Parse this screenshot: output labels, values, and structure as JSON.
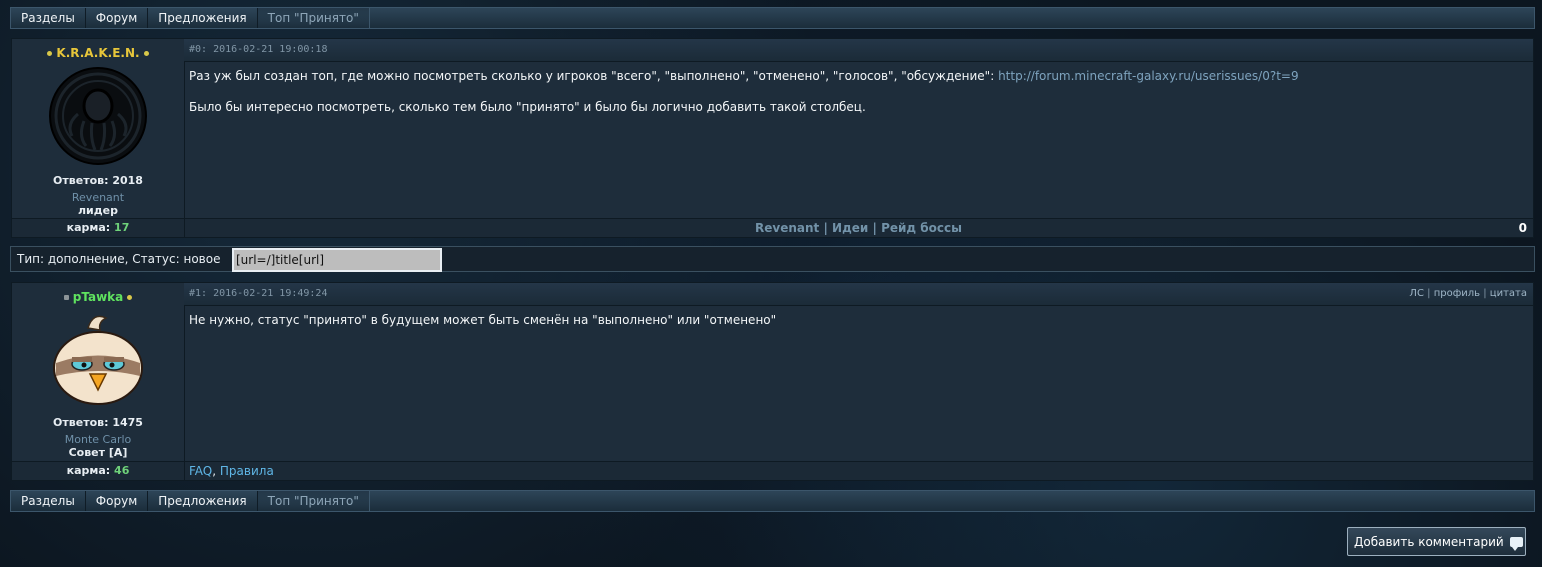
{
  "breadcrumb": {
    "items": [
      "Разделы",
      "Форум",
      "Предложения"
    ],
    "current": "Топ \"Принято\""
  },
  "posts": [
    {
      "author": "K.R.A.K.E.N.",
      "author_color": "#e7c63a",
      "avatar_icon": "kraken-avatar-icon",
      "replies": "Ответов: 2018",
      "clan": "Revenant",
      "rank": "лидер",
      "karma_label": "карма:",
      "karma_value": "17",
      "meta": "#0: 2016-02-21 19:00:18",
      "body_line1_text": "Раз уж был создан топ, где можно посмотреть сколько у игроков \"всего\", \"выполнено\", \"отменено\", \"голосов\", \"обсуждение\": ",
      "body_line1_link": "http://forum.minecraft-galaxy.ru/userissues/0?t=9",
      "body_line2": "Было бы интересно посмотреть, сколько тем было \"принято\" и было бы логично добавить такой столбец.",
      "signature": [
        "Revenant",
        "Идеи",
        "Рейд боссы"
      ],
      "signature_sep": "|",
      "score": "0"
    },
    {
      "author": "pTawka",
      "author_color": "#5fe25f",
      "avatar_icon": "bird-avatar-icon",
      "replies": "Ответов: 1475",
      "clan": "Monte Carlo",
      "rank": "Совет [A]",
      "karma_label": "карма:",
      "karma_value": "46",
      "meta": "#1: 2016-02-21 19:49:24",
      "actions": [
        "ЛС",
        "профиль",
        "цитата"
      ],
      "action_sep": "|",
      "body_line1": "Не нужно, статус \"принято\" в будущем может быть сменён на \"выполнено\" или \"отменено\"",
      "footer_links": [
        "FAQ",
        "Правила"
      ],
      "footer_sep": ","
    }
  ],
  "status": {
    "label": "Тип: дополнение, Статус: новое",
    "field_value": "[url=/]title[url]"
  },
  "add_comment_label": "Добавить комментарий"
}
